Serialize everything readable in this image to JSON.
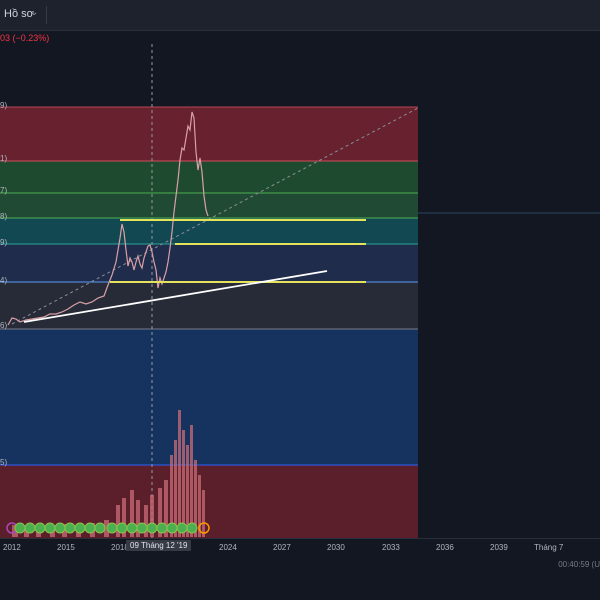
{
  "header": {
    "profile_label": "Hồ sơ",
    "chevron_icon": "chevron-down-icon",
    "change_text": "03 (−0.23%)"
  },
  "fib_labels": [
    "9)",
    "1)",
    "7)",
    "8)",
    "9)",
    "4)",
    "6)",
    "5)"
  ],
  "time_axis": {
    "labels": [
      "2012",
      "2015",
      "2018",
      "2024",
      "2027",
      "2030",
      "2033",
      "2036",
      "2039",
      "Tháng 7"
    ],
    "crosshair_label": "09 Tháng 12 '19"
  },
  "status": {
    "clock": "00:40:59 (U"
  },
  "colors": {
    "background": "#131722",
    "zone_red": "#7a2430",
    "zone_green": "#1c4d2e",
    "zone_teal": "#134d56",
    "zone_navy": "#1f2b4a",
    "zone_grey": "#262a36",
    "zone_blue": "#16325e",
    "hline_yellow": "#e4e35b",
    "trendline": "#ffffff"
  }
}
